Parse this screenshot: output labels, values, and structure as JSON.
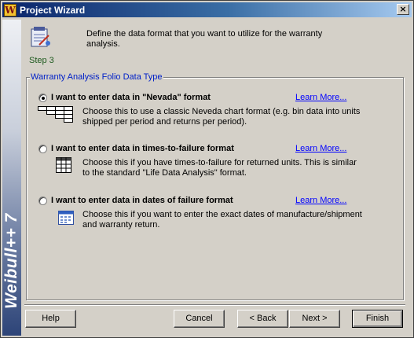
{
  "window": {
    "title": "Project Wizard",
    "app_icon_letter": "W",
    "close_glyph": "×"
  },
  "sidebar": {
    "brand": "Weibull++ 7"
  },
  "header": {
    "step_label": "Step 3",
    "instruction": "Define the data format that you want to utilize for the warranty analysis."
  },
  "group": {
    "title": "Warranty Analysis Folio Data Type",
    "options": [
      {
        "label": "I want to enter data in \"Nevada\" format",
        "description": "Choose this to use a classic Neveda chart format (e.g. bin data into units shipped per period and returns per period).",
        "learn_more": "Learn More...",
        "selected": true,
        "icon": "nevada-grid-icon"
      },
      {
        "label": "I want to enter data in times-to-failure format",
        "description": "Choose this if you have times-to-failure for returned units. This is similar to the standard \"Life Data Analysis\" format.",
        "learn_more": "Learn More...",
        "selected": false,
        "icon": "table-grid-icon"
      },
      {
        "label": "I want to enter data in dates of failure format",
        "description": "Choose this if you want to enter the exact dates of manufacture/shipment and warranty return.",
        "learn_more": "Learn More...",
        "selected": false,
        "icon": "calendar-icon"
      }
    ]
  },
  "buttons": {
    "help": "Help",
    "cancel": "Cancel",
    "back": "< Back",
    "next": "Next >",
    "finish": "Finish"
  },
  "colors": {
    "titlebar_start": "#0a246a",
    "titlebar_end": "#a6caf0",
    "link": "#0000ff",
    "group_title": "#0020c8",
    "step_label": "#1e5a1e"
  }
}
